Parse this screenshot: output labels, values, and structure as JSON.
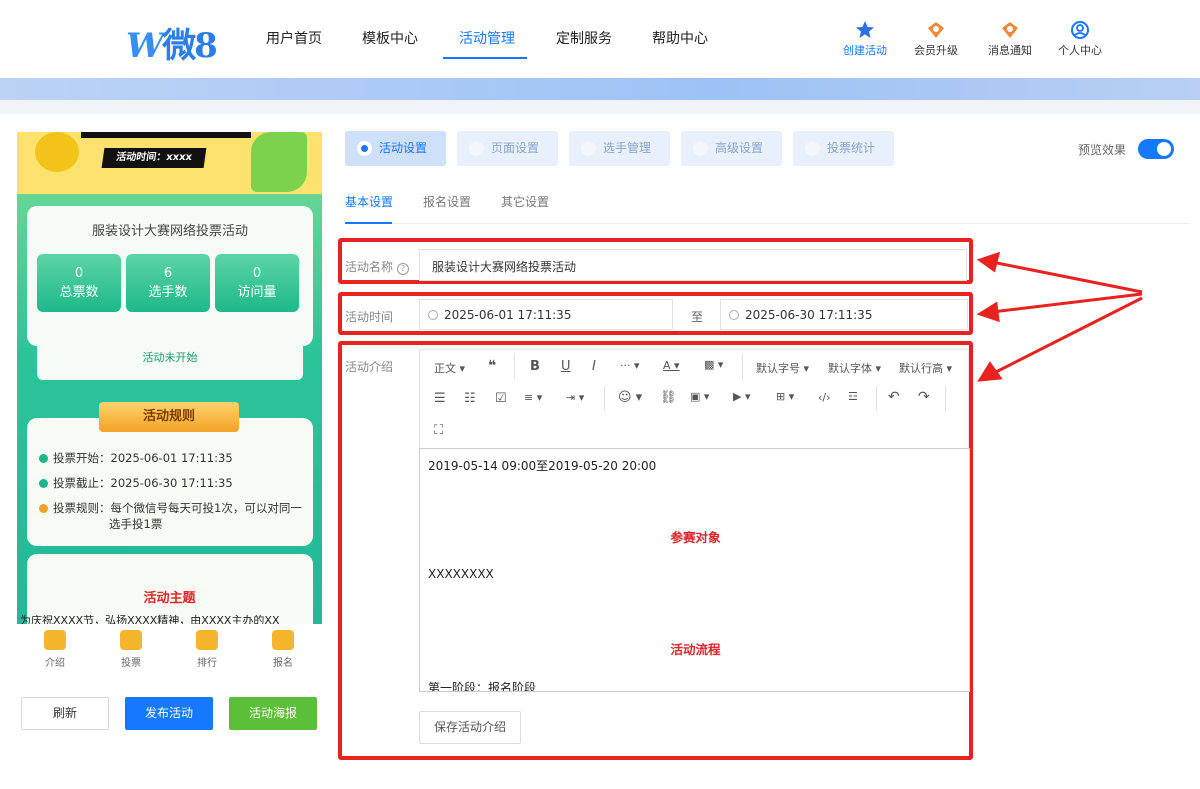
{
  "brand": {
    "logo_text": "微8",
    "logo_letter": "W"
  },
  "nav": {
    "items": [
      {
        "label": "用户首页"
      },
      {
        "label": "模板中心"
      },
      {
        "label": "活动管理",
        "active": true
      },
      {
        "label": "定制服务"
      },
      {
        "label": "帮助中心"
      }
    ],
    "right": [
      {
        "label": "创建活动",
        "icon": "star-create-icon"
      },
      {
        "label": "会员升级",
        "icon": "diamond-icon"
      },
      {
        "label": "消息通知",
        "icon": "bell-icon"
      },
      {
        "label": "个人中心",
        "icon": "user-circle-icon"
      }
    ]
  },
  "preview": {
    "activity_time_label": "活动时间：xxxx",
    "activity_title": "服装设计大赛网络投票活动",
    "stats": [
      {
        "value": "0",
        "label": "总票数"
      },
      {
        "value": "6",
        "label": "选手数"
      },
      {
        "value": "0",
        "label": "访问量"
      }
    ],
    "status": "活动未开始",
    "rules_title": "活动规则",
    "rules": [
      "投票开始：2025-06-01 17:11:35",
      "投票截止：2025-06-30 17:11:35",
      "投票规则：每个微信号每天可投1次，可以对同一",
      "选手投1票"
    ],
    "theme_title": "活动主题",
    "theme_text": "为庆祝XXXX节，弘扬XXXX精神，由XXXX主办的XX",
    "tabs": [
      {
        "label": "介绍"
      },
      {
        "label": "投票"
      },
      {
        "label": "排行"
      },
      {
        "label": "报名"
      }
    ],
    "buttons": {
      "refresh": "刷新",
      "publish": "发布活动",
      "poster": "活动海报"
    }
  },
  "settings": {
    "tabs": [
      {
        "label": "活动设置",
        "active": true
      },
      {
        "label": "页面设置"
      },
      {
        "label": "选手管理"
      },
      {
        "label": "高级设置"
      },
      {
        "label": "投票统计"
      }
    ],
    "preview_toggle_label": "预览效果",
    "preview_toggle_on": true,
    "subtabs": [
      {
        "label": "基本设置",
        "active": true
      },
      {
        "label": "报名设置"
      },
      {
        "label": "其它设置"
      }
    ],
    "name_label": "活动名称",
    "name_value": "服装设计大赛网络投票活动",
    "time_label": "活动时间",
    "time_start": "2025-06-01 17:11:35",
    "time_to": "至",
    "time_end": "2025-06-30 17:11:35",
    "intro_label": "活动介绍",
    "toolbar": {
      "paragraph": "正文",
      "font_size": "默认字号",
      "font_family": "默认字体",
      "line_height": "默认行高"
    },
    "editor": {
      "line1": "2019-05-14 09:00至2019-05-20 20:00",
      "heading1": "参赛对象",
      "line2": "XXXXXXXX",
      "heading2": "活动流程",
      "line3": "第一阶段：报名阶段"
    },
    "save_intro": "保存活动介绍"
  },
  "colors": {
    "accent": "#1677ff",
    "highlight_border": "#e8231f",
    "green": "#5bbf3a"
  }
}
